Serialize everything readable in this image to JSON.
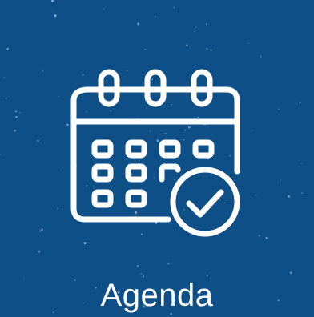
{
  "tile": {
    "label": "Agenda",
    "icon": "calendar-check-icon"
  },
  "colors": {
    "background": "#0d4f86",
    "foreground": "#ffffff",
    "sparkle": "#9ec3e6"
  }
}
